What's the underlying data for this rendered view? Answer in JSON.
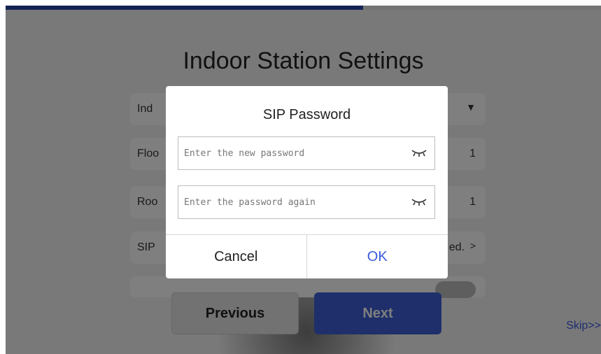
{
  "progress": {
    "percent": 60
  },
  "page": {
    "title": "Indoor Station Settings"
  },
  "rows": [
    {
      "label": "Ind",
      "value": "",
      "control": "dropdown",
      "arrow": "▼"
    },
    {
      "label": "Floo",
      "value": "1"
    },
    {
      "label": "Roo",
      "value": "1"
    },
    {
      "label": "SIP",
      "value": "ed.",
      "arrow": ">"
    }
  ],
  "nav": {
    "previous_label": "Previous",
    "next_label": "Next",
    "skip_label": "Skip>>"
  },
  "dialog": {
    "title": "SIP Password",
    "new_password_placeholder": "Enter the new password",
    "confirm_password_placeholder": "Enter the password again",
    "new_password_value": "",
    "confirm_password_value": "",
    "cancel_label": "Cancel",
    "ok_label": "OK"
  },
  "icons": {
    "password_toggle": "eye-closed-icon",
    "dropdown": "caret-down-icon",
    "row_arrow": "chevron-right-icon"
  },
  "colors": {
    "accent": "#3b5bdb",
    "next_button": "#3d5fd6",
    "progress": "#2b46a8"
  }
}
